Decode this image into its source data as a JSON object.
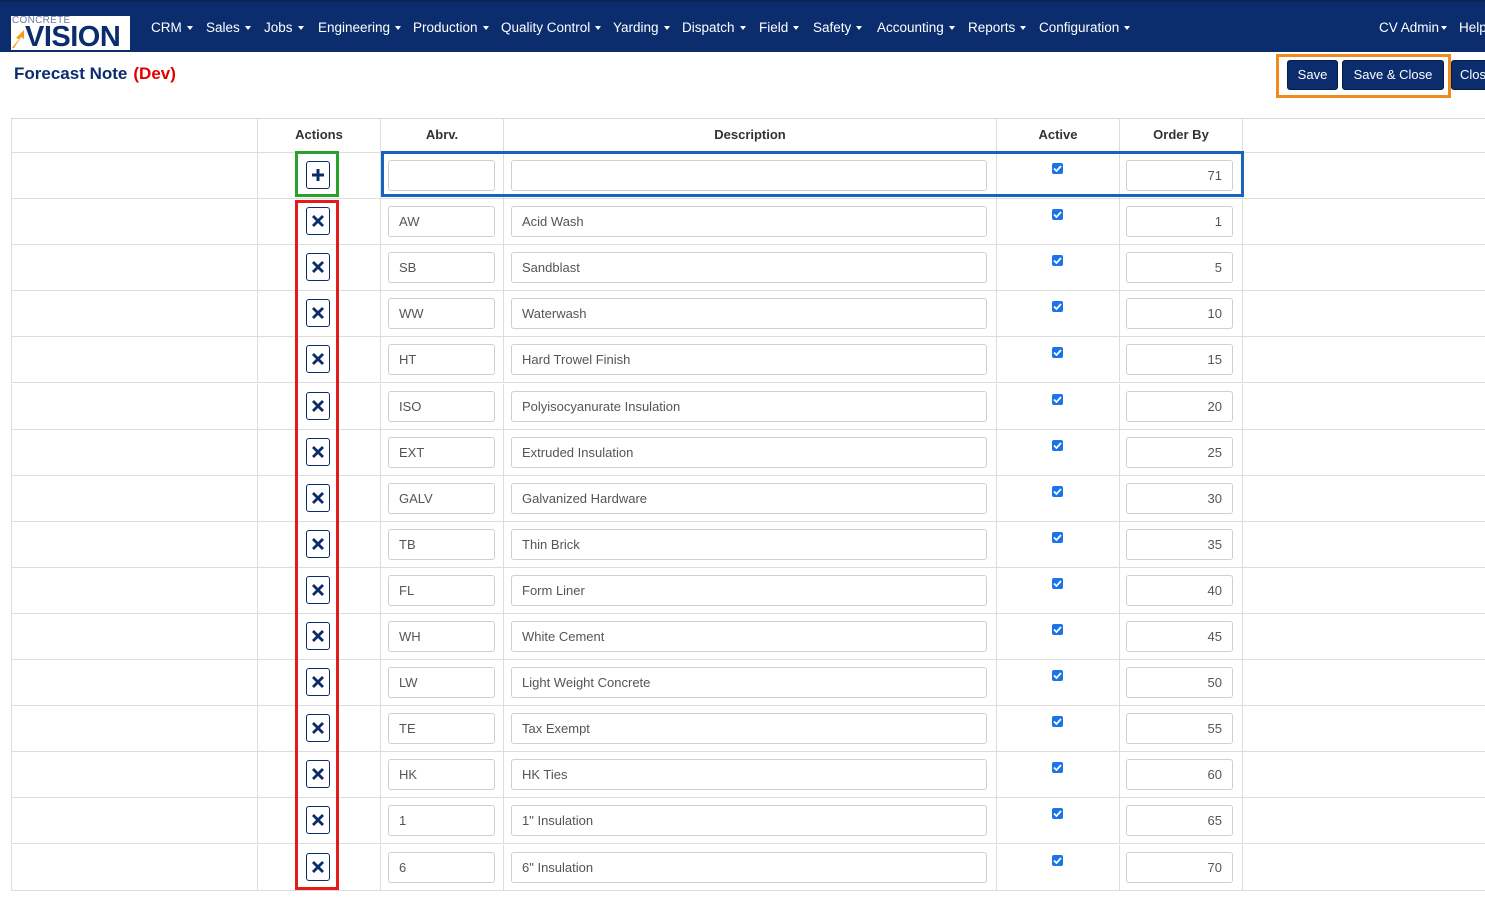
{
  "logo": {
    "top_text": "CONCRETE",
    "main_text": "VISION"
  },
  "nav": {
    "items": [
      "CRM",
      "Sales",
      "Jobs",
      "Engineering",
      "Production",
      "Quality Control",
      "Yarding",
      "Dispatch",
      "Field",
      "Safety",
      "Accounting",
      "Reports",
      "Configuration"
    ],
    "user": "CV Admin",
    "help": "Help"
  },
  "page": {
    "title": "Forecast Note",
    "env": "(Dev)"
  },
  "buttons": {
    "save": "Save",
    "save_close": "Save & Close",
    "close": "Close"
  },
  "table": {
    "headers": {
      "actions": "Actions",
      "abrv": "Abrv.",
      "description": "Description",
      "active": "Active",
      "order_by": "Order By"
    },
    "new_row": {
      "abrv": "",
      "description": "",
      "active": true,
      "order_by": "71"
    },
    "rows": [
      {
        "abrv": "AW",
        "description": "Acid Wash",
        "active": true,
        "order_by": "1"
      },
      {
        "abrv": "SB",
        "description": "Sandblast",
        "active": true,
        "order_by": "5"
      },
      {
        "abrv": "WW",
        "description": "Waterwash",
        "active": true,
        "order_by": "10"
      },
      {
        "abrv": "HT",
        "description": "Hard Trowel Finish",
        "active": true,
        "order_by": "15"
      },
      {
        "abrv": "ISO",
        "description": "Polyisocyanurate Insulation",
        "active": true,
        "order_by": "20"
      },
      {
        "abrv": "EXT",
        "description": "Extruded Insulation",
        "active": true,
        "order_by": "25"
      },
      {
        "abrv": "GALV",
        "description": "Galvanized  Hardware",
        "active": true,
        "order_by": "30"
      },
      {
        "abrv": "TB",
        "description": "Thin Brick",
        "active": true,
        "order_by": "35"
      },
      {
        "abrv": "FL",
        "description": "Form Liner",
        "active": true,
        "order_by": "40"
      },
      {
        "abrv": "WH",
        "description": "White Cement",
        "active": true,
        "order_by": "45"
      },
      {
        "abrv": "LW",
        "description": "Light Weight Concrete",
        "active": true,
        "order_by": "50"
      },
      {
        "abrv": "TE",
        "description": "Tax Exempt",
        "active": true,
        "order_by": "55"
      },
      {
        "abrv": "HK",
        "description": "HK Ties",
        "active": true,
        "order_by": "60"
      },
      {
        "abrv": "1",
        "description": "1\" Insulation",
        "active": true,
        "order_by": "65"
      },
      {
        "abrv": "6",
        "description": "6\" Insulation",
        "active": true,
        "order_by": "70"
      }
    ]
  },
  "icons": {
    "add": "plus-icon",
    "delete": "x-icon",
    "active": "checkbox-checked-icon"
  },
  "colors": {
    "navbar": "#0b2d6e",
    "accent": "#0b2d6e",
    "env": "#e00000",
    "highlight_orange": "#f08a1d",
    "highlight_green": "#2aa12a",
    "highlight_blue": "#1565c0",
    "highlight_red": "#e31b1b"
  }
}
